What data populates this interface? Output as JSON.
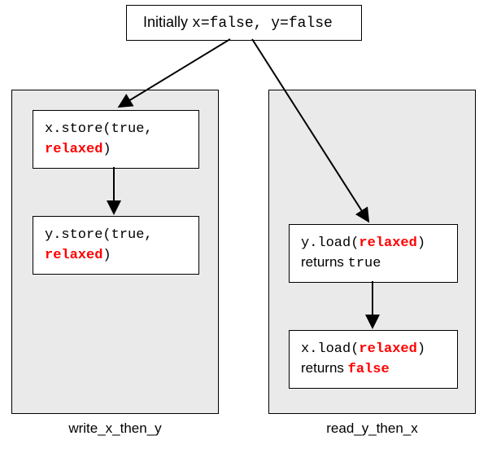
{
  "initial": {
    "prefix": "Initially ",
    "code": "x=false, y=false"
  },
  "thread_left": {
    "label": "write_x_then_y",
    "op1": {
      "line1a": "x.store(true,",
      "line1b_em": "relaxed",
      "line1c": ")"
    },
    "op2": {
      "line1a": "y.store(true,",
      "line1b_em": "relaxed",
      "line1c": ")"
    }
  },
  "thread_right": {
    "label": "read_y_then_x",
    "op1": {
      "line1a": "y.load(",
      "line1b_em": "relaxed",
      "line1c": ")",
      "line2a": "returns ",
      "line2b": "true"
    },
    "op2": {
      "line1a": "x.load(",
      "line1b_em": "relaxed",
      "line1c": ")",
      "line2a": "returns ",
      "line2b_em": "false"
    }
  }
}
